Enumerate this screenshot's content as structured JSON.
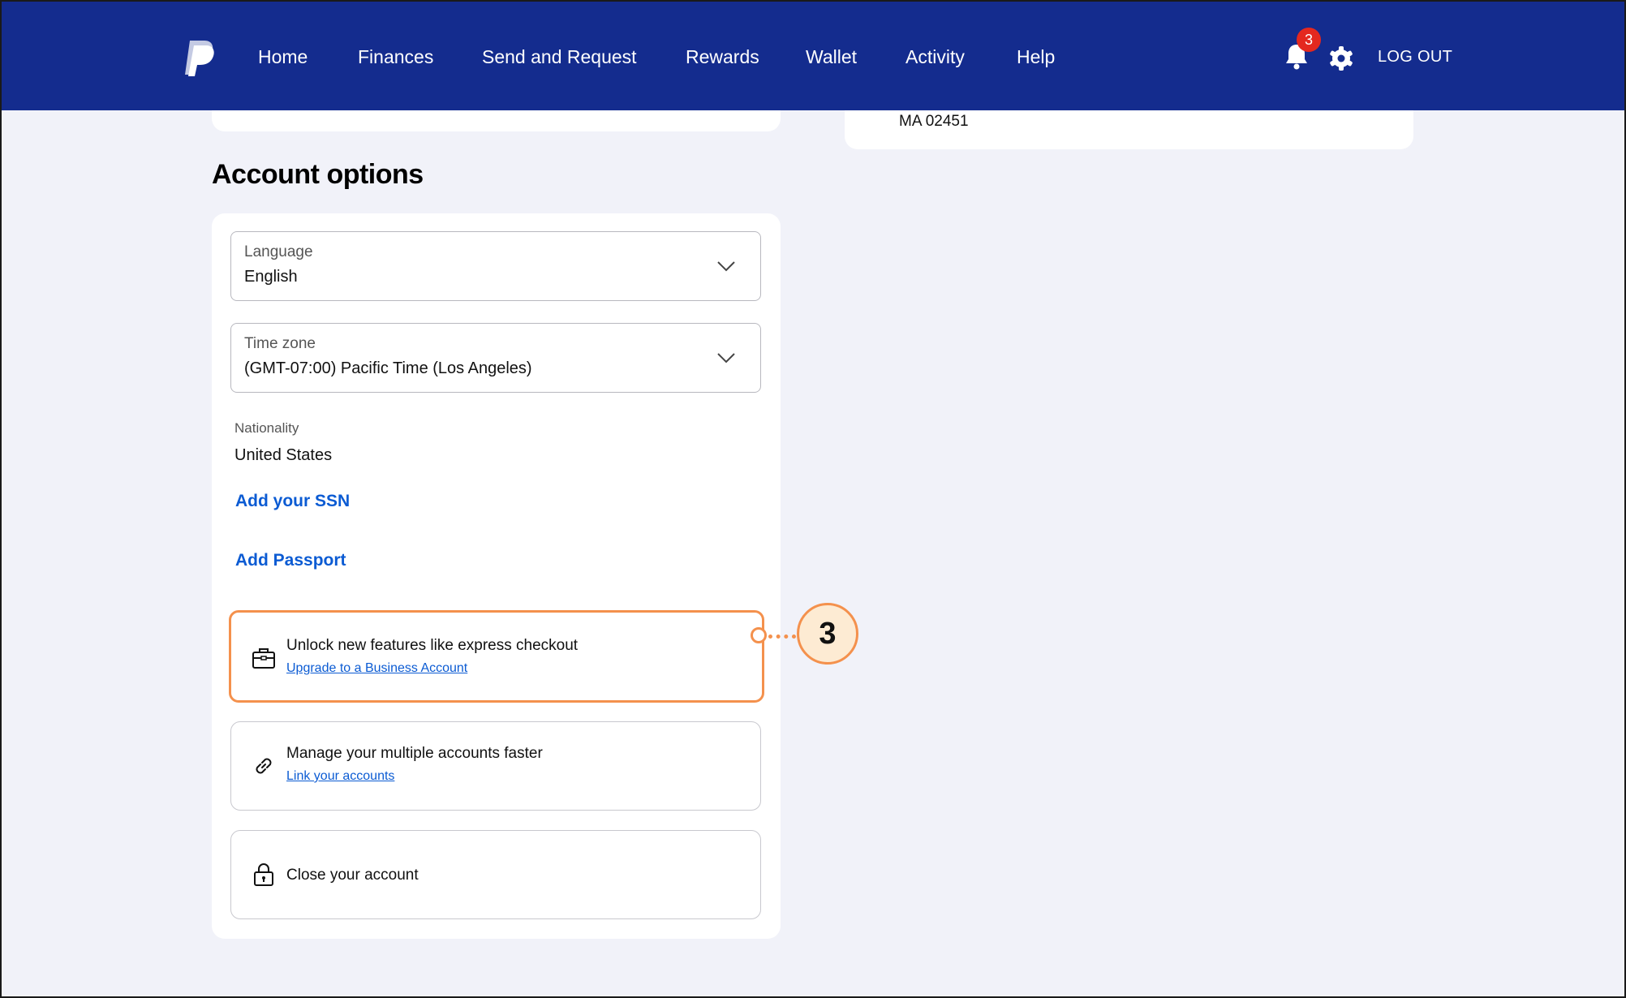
{
  "nav": {
    "items": [
      "Home",
      "Finances",
      "Send and Request",
      "Rewards",
      "Wallet",
      "Activity",
      "Help"
    ],
    "notification_count": "3",
    "logout_label": "LOG OUT"
  },
  "address": {
    "line": "MA 02451"
  },
  "account_options": {
    "title": "Account options",
    "language": {
      "label": "Language",
      "value": "English"
    },
    "timezone": {
      "label": "Time zone",
      "value": "(GMT-07:00) Pacific Time (Los Angeles)"
    },
    "nationality": {
      "label": "Nationality",
      "value": "United States"
    },
    "add_ssn": "Add your SSN",
    "add_passport": "Add Passport",
    "options": [
      {
        "title": "Unlock new features like express checkout",
        "link": "Upgrade to a Business Account",
        "icon": "briefcase-icon"
      },
      {
        "title": "Manage your multiple accounts faster",
        "link": "Link your accounts",
        "icon": "link-icon"
      },
      {
        "title": "Close your account",
        "icon": "lock-icon"
      }
    ]
  },
  "callout": {
    "number": "3"
  },
  "colors": {
    "nav_bg": "#142c8e",
    "link": "#0b5bd3",
    "highlight": "#f4914d",
    "badge": "#e4281f"
  }
}
